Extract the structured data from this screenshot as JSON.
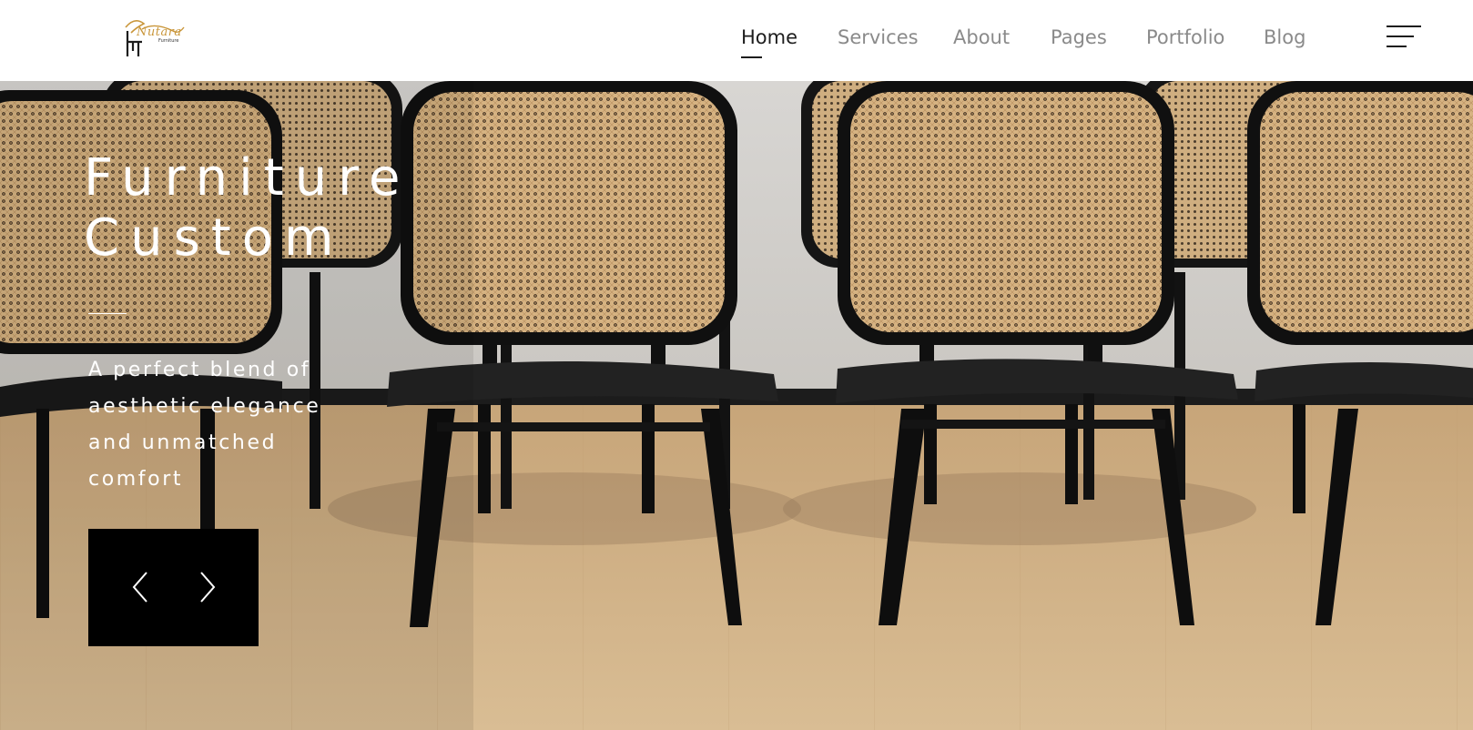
{
  "brand": {
    "logo_text": "Nutara",
    "logo_subtext": "Furniture",
    "accent_color": "#c9963a"
  },
  "nav": {
    "items": [
      {
        "label": "Home",
        "active": true
      },
      {
        "label": "Services",
        "active": false
      },
      {
        "label": "About",
        "active": false
      },
      {
        "label": "Pages",
        "active": false
      },
      {
        "label": "Portfolio",
        "active": false
      },
      {
        "label": "Blog",
        "active": false
      }
    ],
    "menu_icon": "hamburger-menu-icon"
  },
  "hero": {
    "title_line1": "Furniture",
    "title_line2": "Custom",
    "description_lines": [
      "A perfect blend of",
      "aesthetic elegance",
      "and unmatched",
      "comfort"
    ],
    "prev_icon": "chevron-left-icon",
    "next_icon": "chevron-right-icon"
  }
}
